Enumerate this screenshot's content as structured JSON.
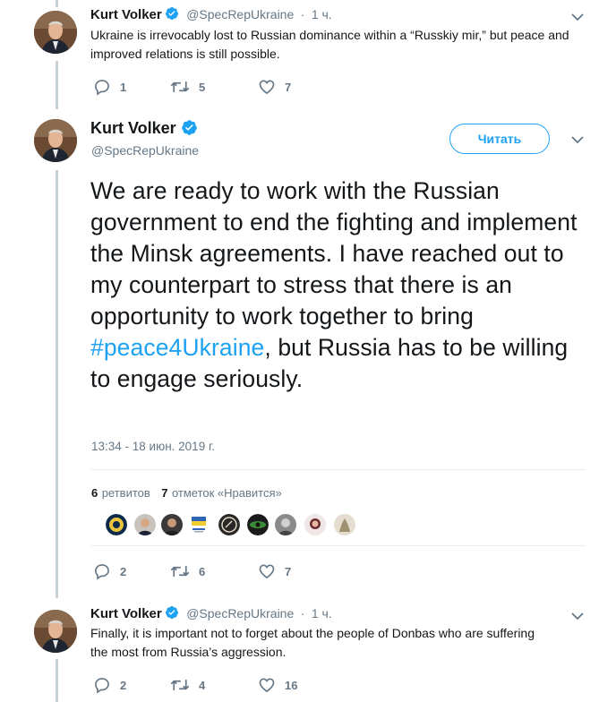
{
  "colors": {
    "accent": "#1da1f2",
    "text_primary": "#14171a",
    "text_secondary": "#657786",
    "thread_line": "#c4cfd6",
    "divider": "#e6ecf0",
    "like_hover": "#e0245e"
  },
  "tweets": [
    {
      "author_name": "Kurt Volker",
      "handle": "@SpecRepUkraine",
      "separator": "·",
      "time": "1 ч.",
      "text": "Ukraine is irrevocably lost to Russian dominance within a “Russkiy mir,” but peace and improved relations is still possible.",
      "reply_count": "1",
      "retweet_count": "5",
      "like_count": "7",
      "icons": [
        "verified-icon",
        "chevron-down-icon",
        "reply-icon",
        "retweet-icon",
        "like-icon"
      ]
    },
    {
      "author_name": "Kurt Volker",
      "handle": "@SpecRepUkraine",
      "follow_label": "Читать",
      "text_before_hashtag": "We are ready to work with the Russian government to end the fighting and implement the Minsk agreements.  I have reached out to my counterpart to stress that there is an opportunity to work together to bring ",
      "hashtag": "#peace4Ukraine",
      "text_after_hashtag": ", but Russia has to be willing to engage seriously.",
      "timestamp": "13:34 - 18 июн. 2019 г.",
      "retweets_num": "6",
      "retweets_label": "ретвитов",
      "likes_num": "7",
      "likes_label": "отметок «Нравится»",
      "likers": [
        "liker-avatar-1",
        "liker-avatar-2",
        "liker-avatar-3",
        "liker-avatar-4",
        "liker-avatar-5",
        "liker-avatar-6",
        "liker-avatar-7",
        "liker-avatar-8",
        "liker-avatar-9"
      ],
      "reply_count": "2",
      "retweet_count": "6",
      "like_count": "7"
    },
    {
      "author_name": "Kurt Volker",
      "handle": "@SpecRepUkraine",
      "separator": "·",
      "time": "1 ч.",
      "text": "Finally, it is important not to forget about the people of Donbas who are suffering the most from Russia’s aggression.",
      "reply_count": "2",
      "retweet_count": "4",
      "like_count": "16"
    }
  ]
}
